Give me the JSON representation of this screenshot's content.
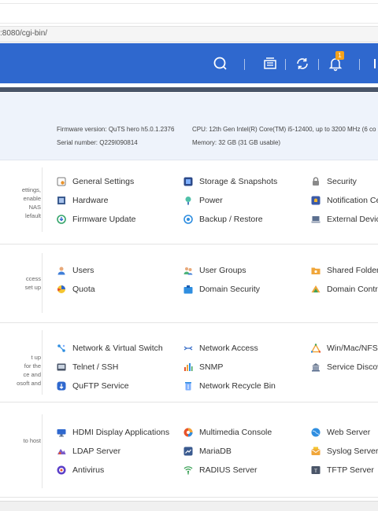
{
  "browser": {
    "address_text": ":8080/cgi-bin/"
  },
  "header": {
    "icons": [
      "search-icon",
      "tasks-icon",
      "sync-icon",
      "notification-icon",
      "profile-icon"
    ],
    "notification_count": "1",
    "accent": "#2f68ce"
  },
  "system_info": {
    "firmware_label": "Firmware version:",
    "firmware_value": "QuTS hero h5.0.1.2376",
    "serial_label": "Serial number:",
    "serial_value": "Q229I090814",
    "cpu_label": "CPU:",
    "cpu_value": "12th Gen Intel(R) Core(TM) i5-12400, up to 3200 MHz (6 co",
    "memory_label": "Memory:",
    "memory_value": "32 GB (31 GB usable)"
  },
  "sections": [
    {
      "description": [
        "ettings,",
        "enable",
        "NAS",
        "lefault"
      ],
      "items": [
        {
          "label": "General Settings",
          "icon": "general-settings-icon"
        },
        {
          "label": "Storage & Snapshots",
          "icon": "storage-icon"
        },
        {
          "label": "Security",
          "icon": "lock-icon"
        },
        {
          "label": "Hardware",
          "icon": "hardware-icon"
        },
        {
          "label": "Power",
          "icon": "power-icon"
        },
        {
          "label": "Notification Ce",
          "icon": "notification-center-icon"
        },
        {
          "label": "Firmware Update",
          "icon": "firmware-update-icon"
        },
        {
          "label": "Backup / Restore",
          "icon": "backup-icon"
        },
        {
          "label": "External Devic",
          "icon": "external-device-icon"
        }
      ]
    },
    {
      "description": [
        "ccess",
        "set up"
      ],
      "items": [
        {
          "label": "Users",
          "icon": "user-icon"
        },
        {
          "label": "User Groups",
          "icon": "user-groups-icon"
        },
        {
          "label": "Shared Folder",
          "icon": "shared-folder-icon"
        },
        {
          "label": "Quota",
          "icon": "quota-icon"
        },
        {
          "label": "Domain Security",
          "icon": "domain-security-icon"
        },
        {
          "label": "Domain Contro",
          "icon": "domain-controller-icon"
        }
      ]
    },
    {
      "description": [
        "t up",
        "for the",
        "ce and",
        "osoft and"
      ],
      "items": [
        {
          "label": "Network & Virtual Switch",
          "icon": "network-switch-icon"
        },
        {
          "label": "Network Access",
          "icon": "network-access-icon"
        },
        {
          "label": "Win/Mac/NFS",
          "icon": "win-mac-nfs-icon"
        },
        {
          "label": "Telnet / SSH",
          "icon": "terminal-icon"
        },
        {
          "label": "SNMP",
          "icon": "snmp-icon"
        },
        {
          "label": "Service Discov",
          "icon": "service-discovery-icon"
        },
        {
          "label": "QuFTP Service",
          "icon": "ftp-icon"
        },
        {
          "label": "Network Recycle Bin",
          "icon": "recycle-bin-icon"
        }
      ]
    },
    {
      "description": [
        "to host"
      ],
      "items": [
        {
          "label": "HDMI Display Applications",
          "icon": "hdmi-icon"
        },
        {
          "label": "Multimedia Console",
          "icon": "multimedia-icon"
        },
        {
          "label": "Web Server",
          "icon": "web-server-icon"
        },
        {
          "label": "LDAP Server",
          "icon": "ldap-icon"
        },
        {
          "label": "MariaDB",
          "icon": "database-icon"
        },
        {
          "label": "Syslog Server",
          "icon": "syslog-icon"
        },
        {
          "label": "Antivirus",
          "icon": "antivirus-icon"
        },
        {
          "label": "RADIUS Server",
          "icon": "radius-icon"
        },
        {
          "label": "TFTP Server",
          "icon": "tftp-icon"
        }
      ]
    }
  ]
}
